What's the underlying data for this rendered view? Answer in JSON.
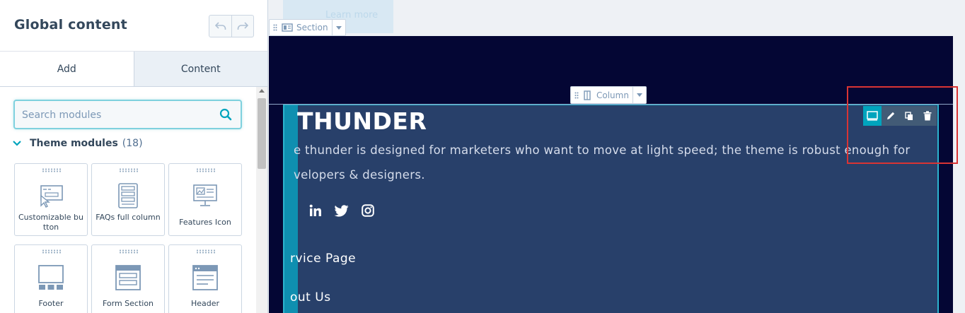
{
  "panel": {
    "title": "Global content",
    "tabs": [
      {
        "label": "Add"
      },
      {
        "label": "Content"
      }
    ],
    "search": {
      "placeholder": "Search modules",
      "value": ""
    },
    "section": {
      "name": "Theme modules",
      "count": "(18)"
    },
    "modules": [
      {
        "label": "Customizable button",
        "icon": "button-icon"
      },
      {
        "label": "FAQs full column",
        "icon": "faq-icon"
      },
      {
        "label": "Features Icon",
        "icon": "features-icon"
      },
      {
        "label": "Footer",
        "icon": "footer-icon"
      },
      {
        "label": "Form Section",
        "icon": "form-icon"
      },
      {
        "label": "Header",
        "icon": "header-icon"
      }
    ]
  },
  "preview": {
    "ghost_button": "Learn more",
    "section_tag": "Section",
    "column_tag": "Column",
    "brand": "THUNDER",
    "description": "e thunder is designed for marketers who want to move at light speed; the theme is robust enough for velopers & designers.",
    "nav_links": [
      "rvice Page",
      "out Us"
    ],
    "social": [
      "linkedin-icon",
      "twitter-icon",
      "instagram-icon"
    ]
  },
  "colors": {
    "accent": "#00a4bd",
    "dark_bg": "#040634",
    "column_bg": "#28406a",
    "highlight": "#d93434"
  }
}
